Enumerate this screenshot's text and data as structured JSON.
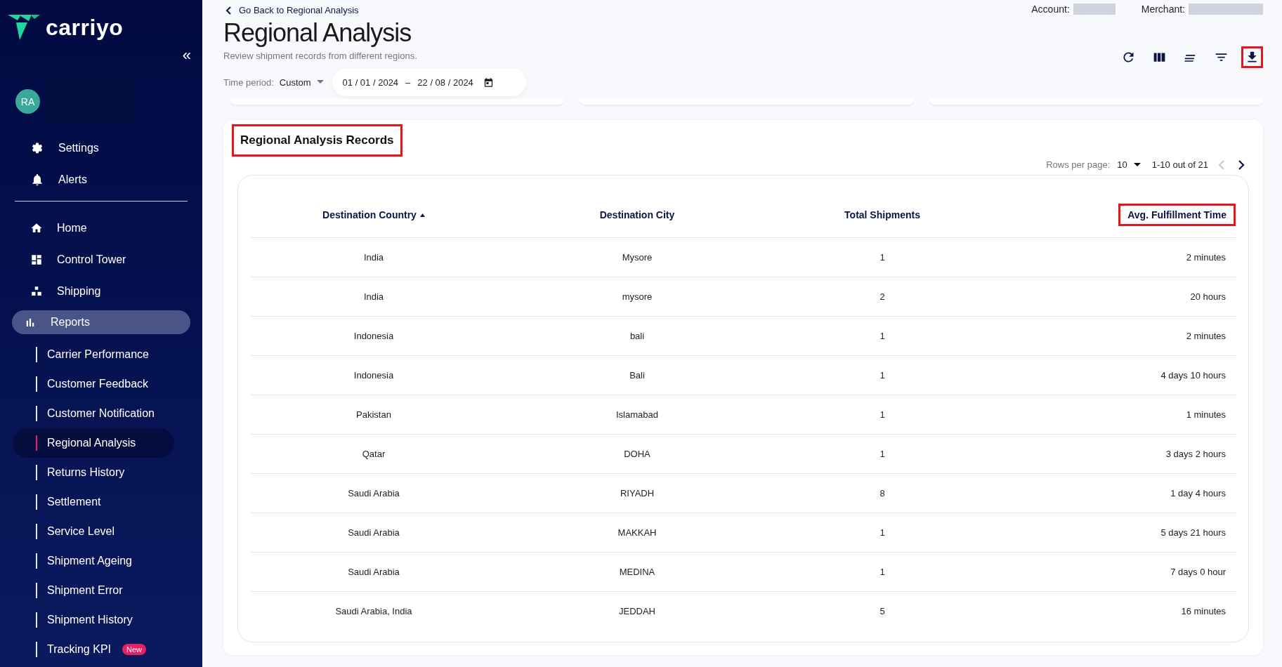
{
  "sidebar": {
    "logo": "carriyo",
    "collapse_button": "«",
    "avatar": "RA",
    "account_items": [
      {
        "label": "Settings"
      },
      {
        "label": "Alerts"
      }
    ],
    "nav": [
      {
        "label": "Home",
        "selected": false
      },
      {
        "label": "Control Tower",
        "selected": false
      },
      {
        "label": "Shipping",
        "selected": false
      },
      {
        "label": "Reports",
        "selected": true,
        "children": [
          {
            "label": "Carrier Performance",
            "selected": false
          },
          {
            "label": "Customer Feedback",
            "selected": false
          },
          {
            "label": "Customer Notification",
            "selected": false
          },
          {
            "label": "Regional Analysis",
            "selected": true
          },
          {
            "label": "Returns History",
            "selected": false
          },
          {
            "label": "Settlement",
            "selected": false
          },
          {
            "label": "Service Level",
            "selected": false
          },
          {
            "label": "Shipment Ageing",
            "selected": false
          },
          {
            "label": "Shipment Error",
            "selected": false
          },
          {
            "label": "Shipment History",
            "selected": false
          },
          {
            "label": "Tracking KPI",
            "selected": false,
            "badge": "New"
          }
        ]
      }
    ]
  },
  "header": {
    "back_link": "Go Back to Regional Analysis",
    "title": "Regional Analysis",
    "subtitle": "Review shipment records from different regions.",
    "account_label": "Account:",
    "merchant_label": "Merchant:",
    "time_period_label": "Time period:",
    "time_period_value": "Custom",
    "date_start": "01 / 01 / 2024",
    "date_separator": "–",
    "date_end": "22 / 08 / 2024",
    "toolbar": [
      {
        "highlighted": false
      },
      {
        "highlighted": false
      },
      {
        "highlighted": false
      },
      {
        "highlighted": false
      },
      {
        "highlighted": true
      }
    ]
  },
  "records": {
    "title": "Regional Analysis Records",
    "title_highlighted": true,
    "rows_per_page_label": "Rows per page:",
    "rows_per_page": "10",
    "range": "1-10 out of 21",
    "prev_disabled": true,
    "next_disabled": false,
    "columns": [
      {
        "label": "Destination Country",
        "sorted": true,
        "highlighted": false
      },
      {
        "label": "Destination City",
        "sorted": false,
        "highlighted": false
      },
      {
        "label": "Total Shipments",
        "sorted": false,
        "highlighted": false
      },
      {
        "label": "Avg. Fulfillment Time",
        "sorted": false,
        "highlighted": true
      }
    ],
    "rows": [
      [
        "India",
        "Mysore",
        "1",
        "2 minutes"
      ],
      [
        "India",
        "mysore",
        "2",
        "20 hours"
      ],
      [
        "Indonesia",
        "bali",
        "1",
        "2 minutes"
      ],
      [
        "Indonesia",
        "Bali",
        "1",
        "4 days 10 hours"
      ],
      [
        "Pakistan",
        "Islamabad",
        "1",
        "1 minutes"
      ],
      [
        "Qatar",
        "DOHA",
        "1",
        "3 days 2 hours"
      ],
      [
        "Saudi Arabia",
        "RIYADH",
        "8",
        "1 day 4 hours"
      ],
      [
        "Saudi Arabia",
        "MAKKAH",
        "1",
        "5 days 21 hours"
      ],
      [
        "Saudi Arabia",
        "MEDINA",
        "1",
        "7 days 0 hour"
      ],
      [
        "Saudi Arabia, India",
        "JEDDAH",
        "5",
        "16 minutes"
      ]
    ]
  }
}
